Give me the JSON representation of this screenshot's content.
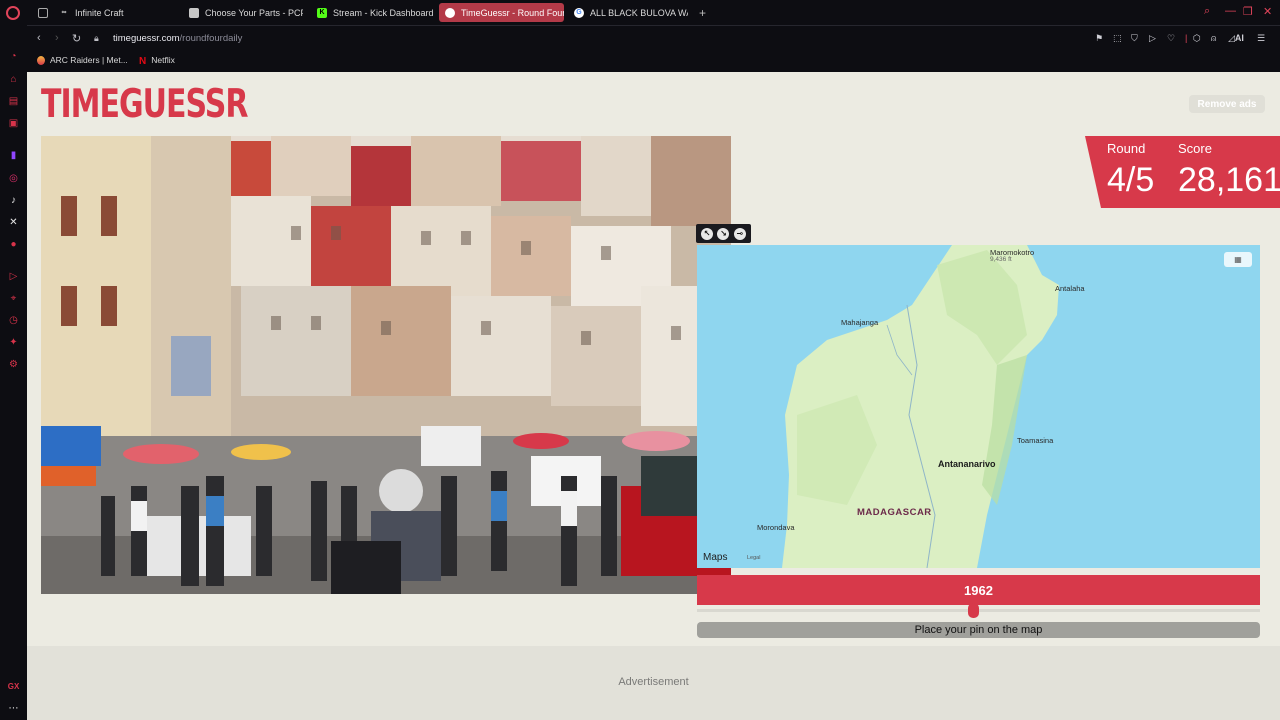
{
  "browser": {
    "tabs": [
      {
        "title": "Infinite Craft",
        "icon": "infinity-icon"
      },
      {
        "title": "Choose Your Parts - PCPa",
        "icon": "pcpartpicker-icon"
      },
      {
        "title": "Stream - Kick Dashboard",
        "icon": "kick-icon"
      },
      {
        "title": "TimeGuessr - Round Four",
        "icon": "globe-icon",
        "active": true
      },
      {
        "title": "ALL BLACK BULOVA WATC",
        "icon": "google-icon"
      }
    ],
    "url_domain": "timeguessr.com",
    "url_path": "/roundfourdaily",
    "bookmarks": [
      {
        "label": "ARC Raiders | Met...",
        "icon": "arc-raiders-icon"
      },
      {
        "label": "Netflix",
        "icon": "netflix-icon"
      }
    ],
    "accent": "#d7394a",
    "ai_label": "AI",
    "sidebar_bottom_label": "GX"
  },
  "site": {
    "logo": "TIMEGUESSR",
    "remove_ads": "Remove ads",
    "round_label": "Round",
    "score_label": "Score",
    "round_value": "4/5",
    "score_value": "28,161",
    "year": "1962",
    "place_pin": "Place your pin on the map",
    "advertisement": "Advertisement"
  },
  "map": {
    "cities": [
      "Maromokotro",
      "9,436 ft",
      "Antalaha",
      "Mahajanga",
      "Toamasina",
      "Antananarivo",
      "Morondava"
    ],
    "country": "MADAGASCAR",
    "maps_brand": "Maps",
    "legal": "Legal"
  }
}
